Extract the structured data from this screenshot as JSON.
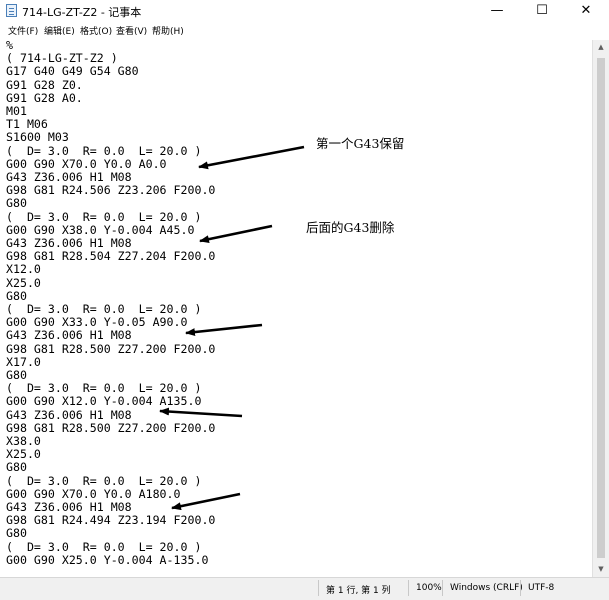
{
  "window": {
    "title": "714-LG-ZT-Z2 - 记事本",
    "minimize_glyph": "—",
    "maximize_glyph": "☐",
    "close_glyph": "✕"
  },
  "menu": [
    "文件(F)",
    "编辑(E)",
    "格式(O)",
    "查看(V)",
    "帮助(H)"
  ],
  "editor": {
    "lines": [
      "%",
      "( 714-LG-ZT-Z2 )",
      "G17 G40 G49 G54 G80",
      "G91 G28 Z0.",
      "G91 G28 A0.",
      "M01",
      "T1 M06",
      "S1600 M03",
      "(  D= 3.0  R= 0.0  L= 20.0 )",
      "G00 G90 X70.0 Y0.0 A0.0",
      "G43 Z36.006 H1 M08",
      "G98 G81 R24.506 Z23.206 F200.0",
      "G80",
      "(  D= 3.0  R= 0.0  L= 20.0 )",
      "G00 G90 X38.0 Y-0.004 A45.0",
      "G43 Z36.006 H1 M08",
      "G98 G81 R28.504 Z27.204 F200.0",
      "X12.0",
      "X25.0",
      "G80",
      "(  D= 3.0  R= 0.0  L= 20.0 )",
      "G00 G90 X33.0 Y-0.05 A90.0",
      "G43 Z36.006 H1 M08",
      "G98 G81 R28.500 Z27.200 F200.0",
      "X17.0",
      "G80",
      "(  D= 3.0  R= 0.0  L= 20.0 )",
      "G00 G90 X12.0 Y-0.004 A135.0",
      "G43 Z36.006 H1 M08",
      "G98 G81 R28.500 Z27.200 F200.0",
      "X38.0",
      "X25.0",
      "G80",
      "(  D= 3.0  R= 0.0  L= 20.0 )",
      "G00 G90 X70.0 Y0.0 A180.0",
      "G43 Z36.006 H1 M08",
      "G98 G81 R24.494 Z23.194 F200.0",
      "G80",
      "(  D= 3.0  R= 0.0  L= 20.0 )",
      "G00 G90 X25.0 Y-0.004 A-135.0"
    ]
  },
  "annotations": {
    "keep_first": "第一个G43保留",
    "delete_rest": "后面的G43删除"
  },
  "statusbar": {
    "position": "第 1 行, 第 1 列",
    "zoom": "100%",
    "line_ending": "Windows (CRLF)",
    "encoding": "UTF-8"
  },
  "colors": {
    "arrow": "#000000",
    "window_bg": "#ffffff",
    "statusbar_bg": "#f0f0f0"
  }
}
